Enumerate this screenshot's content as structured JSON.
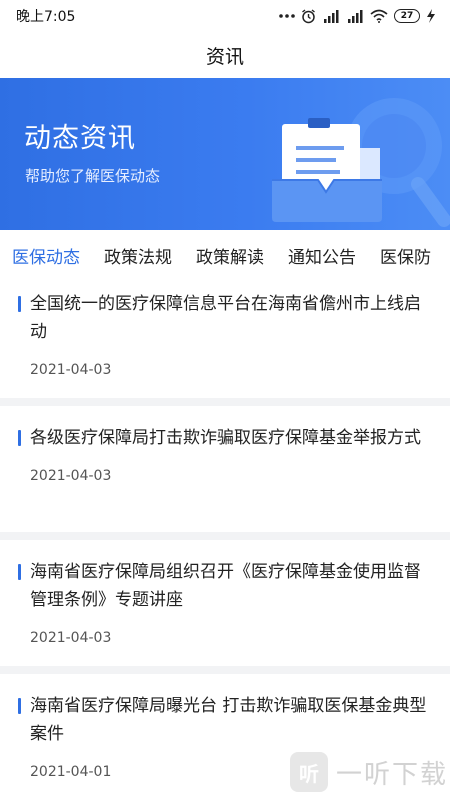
{
  "status_bar": {
    "time": "晚上7:05",
    "battery": "27",
    "icons": [
      "more-dots-icon",
      "alarm-icon",
      "signal-hd-icon",
      "signal-hd-icon",
      "wifi-icon",
      "battery-icon",
      "charging-icon"
    ]
  },
  "nav": {
    "title": "资讯"
  },
  "banner": {
    "title": "动态资讯",
    "subtitle": "帮助您了解医保动态",
    "illustration": "document-search-icon"
  },
  "tabs": [
    {
      "label": "医保动态",
      "active": true
    },
    {
      "label": "政策法规",
      "active": false
    },
    {
      "label": "政策解读",
      "active": false
    },
    {
      "label": "通知公告",
      "active": false
    },
    {
      "label": "医保防",
      "active": false
    }
  ],
  "news": [
    {
      "title": "全国统一的医疗保障信息平台在海南省儋州市上线启动",
      "date": "2021-04-03"
    },
    {
      "title": "各级医疗保障局打击欺诈骗取医疗保障基金举报方式",
      "date": "2021-04-03"
    },
    {
      "title": "海南省医疗保障局组织召开《医疗保障基金使用监督管理条例》专题讲座",
      "date": "2021-04-03"
    },
    {
      "title": "海南省医疗保障局曝光台 打击欺诈骗取医保基金典型案件",
      "date": "2021-04-01"
    }
  ],
  "watermark": {
    "badge": "听",
    "text": "一听下载"
  },
  "colors": {
    "accent": "#2f6fe3",
    "banner": "#3b7cf0",
    "divider": "#f2f3f5"
  }
}
